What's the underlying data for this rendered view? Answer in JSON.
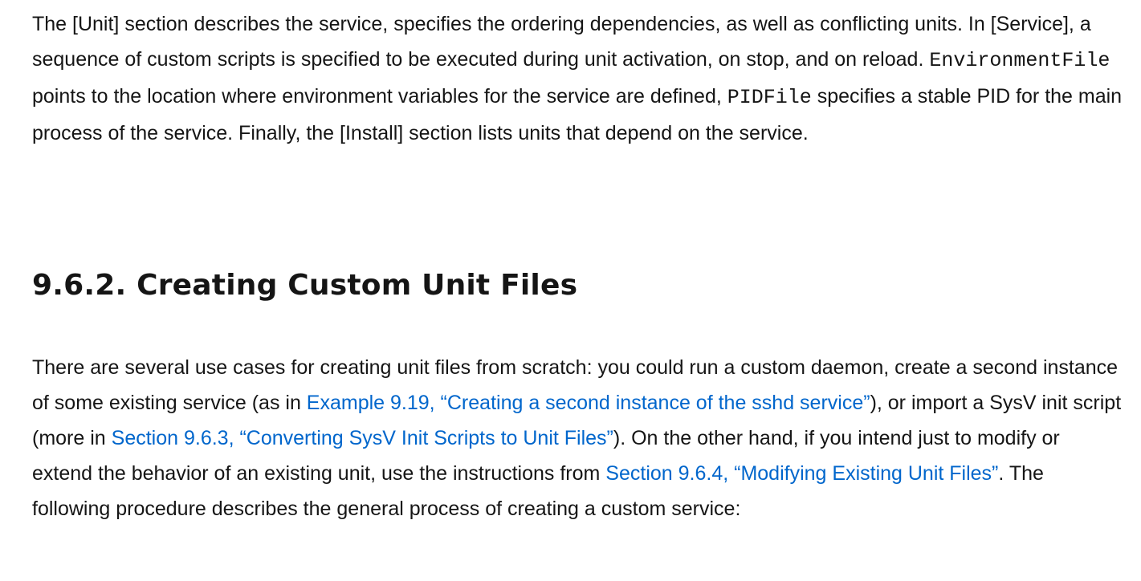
{
  "intro_paragraph": {
    "text_1": "The [Unit] section describes the service, specifies the ordering dependencies, as well as conflicting units. In [Service], a sequence of custom scripts is specified to be executed during unit activation, on stop, and on reload. ",
    "code_1": "EnvironmentFile",
    "text_2": " points to the location where environment variables for the service are defined, ",
    "code_2": "PIDFile",
    "text_3": " specifies a stable PID for the main process of the service. Finally, the [Install] section lists units that depend on the service."
  },
  "section_heading": "9.6.2. Creating Custom Unit Files",
  "body_paragraph": {
    "text_1": "There are several use cases for creating unit files from scratch: you could run a custom daemon, create a second instance of some existing service (as in ",
    "link_1": "Example 9.19, “Creating a second instance of the sshd service”",
    "text_2": "), or import a SysV init script (more in ",
    "link_2": "Section 9.6.3, “Converting SysV Init Scripts to Unit Files”",
    "text_3": "). On the other hand, if you intend just to modify or extend the behavior of an existing unit, use the instructions from ",
    "link_3": "Section 9.6.4, “Modifying Existing Unit Files”",
    "text_4": ". The following procedure describes the general process of creating a custom service:"
  }
}
